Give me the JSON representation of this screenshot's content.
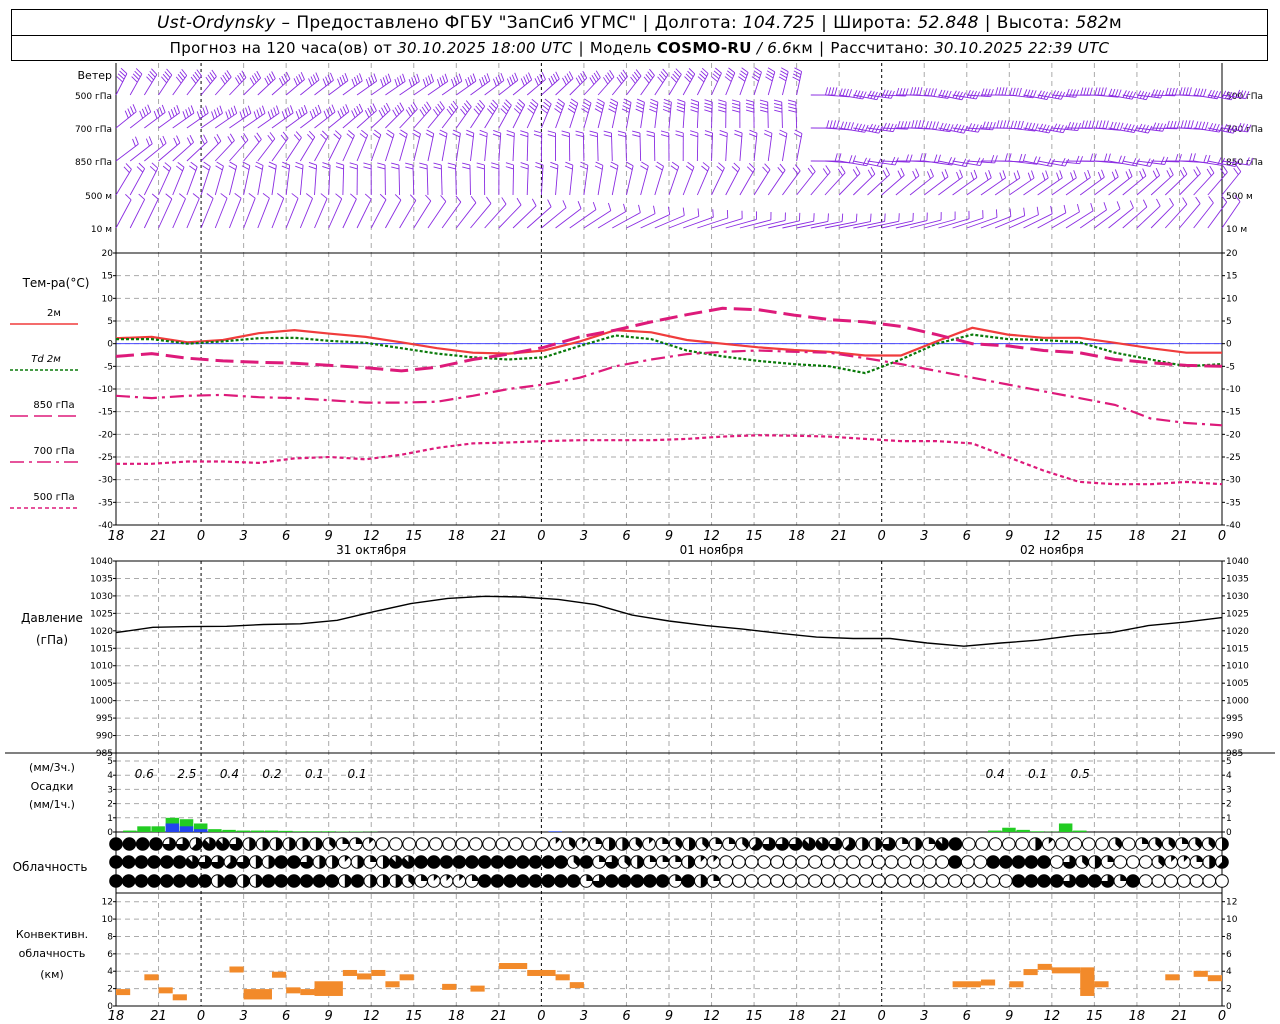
{
  "header": {
    "station": "Ust-Ordynsky",
    "dash": "–",
    "provider": "Предоставлено ФГБУ \"ЗапСиб УГМС\"",
    "lon_label": "Долгота:",
    "lon_value": "104.725",
    "lat_label": "Широта:",
    "lat_value": "52.848",
    "alt_label": "Высота:",
    "alt_value": "582",
    "alt_unit": "м",
    "forecast_label": "Прогноз на 120 часа(ов)  от",
    "forecast_start": "30.10.2025 18:00 UTC",
    "model_label": "Модель",
    "model_name": "COSMO-RU",
    "model_res": "/ 6.6",
    "model_res_unit": "км",
    "calc_label": "Рассчитано:",
    "calc_time": "30.10.2025 22:39 UTC"
  },
  "panels": {
    "wind": {
      "title": "Ветер",
      "levels": [
        "500 гПа",
        "700 гПа",
        "850 гПа",
        "500  м",
        "10   м"
      ]
    },
    "temp": {
      "title": "Тем-ра(°С)",
      "ticks": [
        "20",
        "15",
        "10",
        "5",
        "0",
        "-5",
        "-10",
        "-15",
        "-20",
        "-25",
        "-30",
        "-35",
        "-40"
      ],
      "legend": [
        {
          "label": "2м",
          "color": "#f03c3c"
        },
        {
          "label": "Td  2м",
          "color": "#0a7a0a"
        },
        {
          "label": "850 гПа",
          "color": "#dd1a7a"
        },
        {
          "label": "700 гПа",
          "color": "#dd1a7a"
        },
        {
          "label": "500 гПа",
          "color": "#dd1a7a"
        }
      ]
    },
    "pressure": {
      "title": "Давление",
      "unit": "(гПа)",
      "ticks": [
        "1040",
        "1035",
        "1030",
        "1025",
        "1020",
        "1015",
        "1010",
        "1005",
        "1000",
        "995",
        "990",
        "985"
      ]
    },
    "precip": {
      "unit3": "(мм/3ч.)",
      "title": "Осадки",
      "unit1": "(мм/1ч.)",
      "ticks": [
        "5",
        "4",
        "3",
        "2",
        "1",
        "0"
      ],
      "totals": [
        {
          "h": 2,
          "v": "0.6"
        },
        {
          "h": 5,
          "v": "2.5"
        },
        {
          "h": 8,
          "v": "0.4"
        },
        {
          "h": 11,
          "v": "0.2"
        },
        {
          "h": 14,
          "v": "0.1"
        },
        {
          "h": 17,
          "v": "0.1"
        },
        {
          "h": 62,
          "v": "0.4"
        },
        {
          "h": 65,
          "v": "0.1"
        },
        {
          "h": 68,
          "v": "0.5"
        }
      ]
    },
    "cloud": {
      "title": "Облачность"
    },
    "conv": {
      "title1": "Конвективн.",
      "title2": "облачность",
      "unit": "(км)",
      "ticks": [
        "12",
        "10",
        "8",
        "6",
        "4",
        "2",
        "0"
      ]
    }
  },
  "time_axis": {
    "labels": [
      "18",
      "21",
      "0",
      "3",
      "6",
      "9",
      "12",
      "15",
      "18",
      "21",
      "0",
      "3",
      "6",
      "9",
      "12",
      "15",
      "18",
      "21",
      "0",
      "3",
      "6",
      "9",
      "12",
      "15",
      "18",
      "21",
      "0"
    ],
    "dates": [
      "31 октября",
      "01 ноября",
      "02 ноября"
    ]
  },
  "chart_data": {
    "type": "line",
    "x_hours_from_start": [
      0,
      3,
      6,
      9,
      12,
      15,
      18,
      21,
      24,
      27,
      30,
      33,
      36,
      39,
      42,
      45,
      48,
      51,
      54,
      57,
      60,
      63,
      66,
      69,
      72,
      75,
      78
    ],
    "temperature": {
      "ylim": [
        -40,
        20
      ],
      "series": [
        {
          "name": "2м",
          "color": "#f03c3c",
          "values": [
            1.2,
            1.5,
            0.3,
            0.8,
            2.3,
            3.0,
            2.2,
            1.5,
            0.3,
            -1.0,
            -2.0,
            -2.2,
            -1.5,
            0.5,
            3.0,
            2.5,
            0.8,
            0.0,
            -0.8,
            -1.4,
            -1.8,
            -2.6,
            -2.6,
            0.5,
            3.5,
            2.0,
            1.3,
            1.3,
            0.2,
            -1.0,
            -2.0,
            -2.0
          ]
        },
        {
          "name": "Td  2м",
          "color": "#0a7a0a",
          "values": [
            1.0,
            1.0,
            0.0,
            0.5,
            1.2,
            1.3,
            0.6,
            0.2,
            -1.0,
            -2.2,
            -3.0,
            -3.5,
            -3.0,
            -0.5,
            1.8,
            1.0,
            -1.5,
            -2.8,
            -3.8,
            -4.5,
            -5.0,
            -6.5,
            -3.5,
            0.0,
            2.0,
            1.0,
            0.8,
            0.3,
            -2.0,
            -3.5,
            -5.0,
            -4.5
          ]
        },
        {
          "name": "850 гПа",
          "color": "#dd1a7a",
          "values": [
            -2.8,
            -2.2,
            -3.2,
            -3.8,
            -4.1,
            -4.3,
            -4.8,
            -5.3,
            -6.0,
            -5.2,
            -3.5,
            -2.3,
            -0.8,
            1.5,
            3.0,
            4.8,
            6.4,
            7.8,
            7.5,
            6.3,
            5.3,
            4.8,
            3.8,
            2.0,
            0.0,
            -0.5,
            -1.5,
            -2.0,
            -3.5,
            -4.2,
            -4.8,
            -5.0
          ]
        },
        {
          "name": "700 гПа",
          "color": "#dd1a7a",
          "values": [
            -11.5,
            -12.0,
            -11.5,
            -11.3,
            -11.8,
            -12.0,
            -12.5,
            -13.0,
            -13.0,
            -12.8,
            -11.5,
            -10.0,
            -9.0,
            -7.5,
            -5.0,
            -3.5,
            -2.3,
            -1.8,
            -1.5,
            -1.8,
            -2.0,
            -3.2,
            -4.5,
            -6.0,
            -7.5,
            -9.0,
            -10.5,
            -12.0,
            -13.5,
            -16.5,
            -17.5,
            -18.0
          ]
        },
        {
          "name": "500 гПа",
          "color": "#dd1a7a",
          "values": [
            -26.5,
            -26.5,
            -26.0,
            -26.0,
            -26.3,
            -25.3,
            -25.0,
            -25.5,
            -24.5,
            -23.0,
            -22.0,
            -21.8,
            -21.5,
            -21.3,
            -21.3,
            -21.3,
            -21.0,
            -20.5,
            -20.2,
            -20.3,
            -20.5,
            -21.0,
            -21.5,
            -21.5,
            -22.0,
            -25.0,
            -28.0,
            -30.5,
            -31.0,
            -31.0,
            -30.5,
            -31.0
          ]
        }
      ]
    },
    "pressure": {
      "ylim": [
        985,
        1040
      ],
      "series": [
        {
          "name": "",
          "color": "#000000",
          "values": [
            1019.5,
            1021,
            1021.2,
            1021.3,
            1021.8,
            1022,
            1023,
            1025.5,
            1027.8,
            1029.3,
            1029.9,
            1029.7,
            1029.0,
            1027.5,
            1024.5,
            1022.8,
            1021.5,
            1020.5,
            1019.3,
            1018.2,
            1017.8,
            1017.8,
            1016.5,
            1015.6,
            1016.5,
            1017.3,
            1018.7,
            1019.5,
            1021.5,
            1022.5,
            1023.8
          ]
        }
      ]
    },
    "precip_hourly": {
      "ylim": [
        0,
        5
      ],
      "green": [
        [
          1,
          0.1
        ],
        [
          2,
          0.4
        ],
        [
          3,
          0.4
        ],
        [
          4,
          1.0
        ],
        [
          5,
          0.9
        ],
        [
          6,
          0.6
        ],
        [
          7,
          0.2
        ],
        [
          8,
          0.15
        ],
        [
          9,
          0.1
        ],
        [
          10,
          0.1
        ],
        [
          11,
          0.1
        ],
        [
          12,
          0.08
        ],
        [
          13,
          0.05
        ],
        [
          14,
          0.05
        ],
        [
          15,
          0.05
        ],
        [
          16,
          0.03
        ],
        [
          17,
          0.03
        ],
        [
          18,
          0.02
        ],
        [
          62,
          0.1
        ],
        [
          63,
          0.3
        ],
        [
          64,
          0.15
        ],
        [
          65,
          0.05
        ],
        [
          66,
          0.02
        ],
        [
          67,
          0.6
        ],
        [
          68,
          0.1
        ]
      ],
      "blue": [
        [
          4,
          0.6
        ],
        [
          5,
          0.4
        ],
        [
          6,
          0.2
        ],
        [
          31,
          0.05
        ]
      ]
    },
    "cloud_cover_octas": {
      "high": [
        8,
        8,
        8,
        8,
        6,
        6,
        5,
        7,
        7,
        6,
        4,
        4,
        4,
        4,
        4,
        4,
        3,
        2,
        2,
        1,
        0,
        0,
        0,
        0,
        0,
        0,
        0,
        0,
        0,
        0,
        0,
        0,
        0,
        1,
        3,
        1,
        2,
        4,
        4,
        3,
        1,
        2,
        3,
        4,
        3,
        2,
        2,
        3,
        5,
        6,
        6,
        6,
        7,
        7,
        6,
        5,
        4,
        4,
        6,
        2,
        4,
        2,
        7,
        8,
        0,
        0,
        0,
        0,
        0,
        4,
        1,
        0,
        0,
        0,
        0,
        3,
        0,
        2,
        3,
        3,
        2,
        3,
        3,
        4
      ],
      "middle": [
        8,
        8,
        8,
        8,
        8,
        8,
        7,
        6,
        6,
        5,
        6,
        4,
        4,
        8,
        8,
        6,
        4,
        4,
        1,
        4,
        2,
        4,
        7,
        7,
        8,
        8,
        8,
        8,
        8,
        8,
        8,
        8,
        8,
        8,
        8,
        8,
        3,
        8,
        2,
        6,
        3,
        4,
        2,
        2,
        2,
        4,
        1,
        1,
        0,
        0,
        0,
        0,
        0,
        0,
        0,
        0,
        0,
        0,
        0,
        0,
        0,
        0,
        0,
        0,
        0,
        0,
        8,
        0,
        0,
        8,
        8,
        8,
        8,
        8,
        0,
        6,
        3,
        4,
        2,
        0,
        0,
        0,
        3,
        1,
        1,
        2,
        4,
        5
      ],
      "low": [
        8,
        8,
        8,
        8,
        8,
        8,
        8,
        8,
        4,
        8,
        4,
        4,
        8,
        8,
        8,
        8,
        8,
        8,
        4,
        8,
        4,
        4,
        4,
        3,
        2,
        1,
        1,
        1,
        2,
        8,
        8,
        8,
        8,
        8,
        8,
        8,
        8,
        2,
        6,
        8,
        8,
        8,
        8,
        8,
        2,
        8,
        4,
        2,
        0,
        0,
        0,
        0,
        0,
        0,
        0,
        0,
        0,
        0,
        0,
        0,
        0,
        0,
        0,
        0,
        0,
        0,
        0,
        0,
        0,
        0,
        0,
        8,
        8,
        8,
        8,
        6,
        8,
        8,
        6,
        2,
        8,
        0,
        0,
        0,
        0,
        0,
        0,
        0
      ]
    },
    "convective_cloud_km": {
      "ylim": [
        0,
        13
      ],
      "segments": [
        [
          0,
          1,
          1.6,
          1.6
        ],
        [
          2,
          3,
          3.3,
          3.3
        ],
        [
          3,
          4,
          1.8,
          1.8
        ],
        [
          4,
          5,
          1.0,
          1.0
        ],
        [
          8,
          9,
          4.2,
          4.2
        ],
        [
          9,
          11,
          1.1,
          1.6
        ],
        [
          11,
          12,
          3.6,
          3.6
        ],
        [
          12,
          13,
          1.8,
          1.8
        ],
        [
          13,
          14,
          1.6,
          1.6
        ],
        [
          14,
          16,
          1.5,
          2.5
        ],
        [
          16,
          17,
          3.8,
          3.8
        ],
        [
          17,
          18,
          3.4,
          3.4
        ],
        [
          18,
          19,
          3.8,
          3.8
        ],
        [
          19,
          20,
          2.5,
          2.5
        ],
        [
          20,
          21,
          3.3,
          3.3
        ],
        [
          23,
          24,
          2.2,
          2.2
        ],
        [
          25,
          26,
          2.0,
          2.0
        ],
        [
          27,
          29,
          4.6,
          4.6
        ],
        [
          29,
          31,
          3.8,
          3.8
        ],
        [
          31,
          32,
          3.3,
          3.3
        ],
        [
          32,
          33,
          2.4,
          2.4
        ],
        [
          59,
          61,
          2.5,
          2.5
        ],
        [
          61,
          62,
          2.7,
          2.7
        ],
        [
          63,
          64,
          2.5,
          2.5
        ],
        [
          64,
          65,
          3.9,
          3.9
        ],
        [
          65,
          66,
          4.5,
          4.5
        ],
        [
          66,
          68,
          4.1,
          4.1
        ],
        [
          68,
          69,
          1.5,
          4.1
        ],
        [
          69,
          70,
          2.5,
          2.5
        ],
        [
          74,
          75,
          3.3,
          3.3
        ],
        [
          76,
          77,
          3.7,
          3.7
        ],
        [
          77,
          78,
          3.2,
          3.2
        ]
      ]
    }
  }
}
